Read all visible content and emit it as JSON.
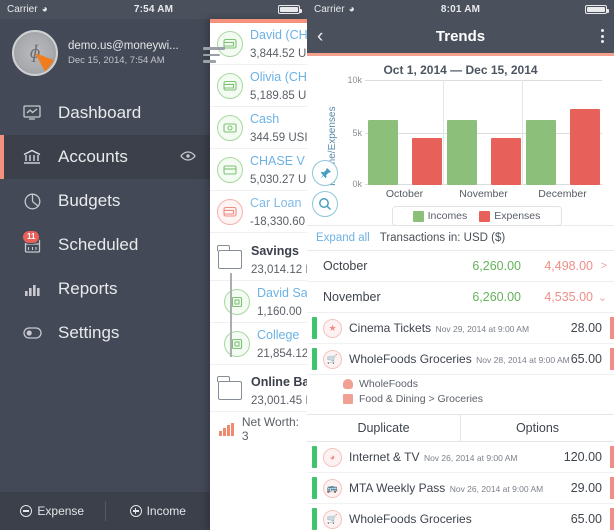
{
  "left": {
    "statusbar": {
      "carrier": "Carrier",
      "wifi": "wifi-icon",
      "time": "7:54 AM"
    },
    "profile": {
      "email": "demo.us@moneywi...",
      "date": "Dec 15, 2014, 7:54 AM"
    },
    "menu": [
      {
        "label": "Dashboard",
        "icon": "dashboard-icon",
        "active": false,
        "badge": null
      },
      {
        "label": "Accounts",
        "icon": "bank-icon",
        "active": true,
        "badge": null,
        "eye": true
      },
      {
        "label": "Budgets",
        "icon": "pie-chart-icon",
        "active": false,
        "badge": null
      },
      {
        "label": "Scheduled",
        "icon": "calendar-icon",
        "active": false,
        "badge": "11"
      },
      {
        "label": "Reports",
        "icon": "bar-chart-icon",
        "active": false,
        "badge": null
      },
      {
        "label": "Settings",
        "icon": "toggle-icon",
        "active": false,
        "badge": null
      }
    ],
    "bottom": {
      "expense": "Expense",
      "income": "Income"
    },
    "accounts": [
      {
        "name": "David (CH",
        "amount": "3,844.52 U",
        "kind": "wallet",
        "tone": "green",
        "indent": 0
      },
      {
        "name": "Olivia (CH",
        "amount": "5,189.85 U",
        "kind": "wallet",
        "tone": "green",
        "indent": 0
      },
      {
        "name": "Cash",
        "amount": "344.59 USI",
        "kind": "cash",
        "tone": "green",
        "indent": 0
      },
      {
        "name": "CHASE V",
        "amount": "5,030.27 U",
        "kind": "card",
        "tone": "green",
        "indent": 0
      },
      {
        "name": "Car Loan",
        "amount": "-18,330.60",
        "kind": "wallet",
        "tone": "red",
        "indent": 0
      },
      {
        "name": "Savings",
        "amount": "23,014.12 I",
        "kind": "folder",
        "tone": "none",
        "indent": 0
      },
      {
        "name": "David Sа",
        "amount": "1,160.00",
        "kind": "savings",
        "tone": "green",
        "indent": 1
      },
      {
        "name": "College",
        "amount": "21,854.12",
        "kind": "savings",
        "tone": "green",
        "indent": 1
      },
      {
        "name": "Online Bа",
        "amount": "23,001.45 I",
        "kind": "folder",
        "tone": "none",
        "indent": 0
      }
    ],
    "networth": {
      "label": "Net Worth: 3",
      "icon": "bar-chart-icon"
    }
  },
  "right": {
    "statusbar": {
      "carrier": "Carrier",
      "wifi": "wifi-icon",
      "time": "8:01 AM"
    },
    "navbar": {
      "back": "back-chevron-icon",
      "title": "Trends",
      "menu": "kebab-menu-icon"
    },
    "daterange": "Oct 1, 2014 — Dec 15, 2014",
    "sidebuttons": [
      {
        "icon": "pin-icon"
      },
      {
        "icon": "search-icon"
      }
    ],
    "txbar": {
      "expand_all": "Expand all",
      "transactions_in": "Transactions in: USD ($)"
    },
    "months": [
      {
        "name": "October",
        "income": "6,260.00",
        "expense": "4,498.00",
        "arrow": ">"
      },
      {
        "name": "November",
        "income": "6,260.00",
        "expense": "4,535.00",
        "arrow": "⌄"
      }
    ],
    "transactions": [
      {
        "name": "Cinema Tickets",
        "date": "Nov 29, 2014 at 9:00 AM",
        "amount": "28.00",
        "icon": "star-icon",
        "meta": []
      },
      {
        "name": "WholeFoods Groceries",
        "date": "Nov 28, 2014 at 9:00 AM",
        "amount": "65.00",
        "icon": "cart-icon",
        "meta": [
          {
            "icon": "person-icon",
            "text": "WholeFoods"
          },
          {
            "icon": "tag-icon",
            "text": "Food & Dining > Groceries"
          }
        ]
      },
      {
        "name": "Internet & TV",
        "date": "Nov 26, 2014 at 9:00 AM",
        "amount": "120.00",
        "icon": "wifi-icon",
        "meta": []
      },
      {
        "name": "MTA Weekly Pass",
        "date": "Nov 26, 2014 at 9:00 AM",
        "amount": "29.00",
        "icon": "bus-icon",
        "meta": []
      },
      {
        "name": "WholeFoods Groceries",
        "date": "",
        "amount": "65.00",
        "icon": "cart-icon",
        "meta": []
      }
    ],
    "actionbar": {
      "duplicate": "Duplicate",
      "options": "Options"
    }
  },
  "colors": {
    "sidebar_bg": "#434956",
    "navbar_bg": "#4a505c",
    "accent_orange": "#f4927e",
    "income_green": "#8cc07a",
    "expense_red": "#e8605a",
    "link_blue": "#6cb2e4"
  },
  "chart_data": {
    "type": "bar",
    "title": "Oct 1, 2014 — Dec 15, 2014",
    "xlabel": "",
    "ylabel": "Income/Expenses",
    "categories": [
      "October",
      "November",
      "December"
    ],
    "series": [
      {
        "name": "Incomes",
        "values": [
          6260,
          6260,
          6260
        ],
        "color": "#8cc07a"
      },
      {
        "name": "Expenses",
        "values": [
          4498,
          4535,
          7300
        ],
        "color": "#e8605a"
      }
    ],
    "ylim": [
      0,
      10000
    ],
    "yticks": [
      0,
      5000,
      10000
    ],
    "ytick_labels": [
      "0k",
      "5k",
      "10k"
    ],
    "grid": true,
    "legend": "bottom-center"
  }
}
